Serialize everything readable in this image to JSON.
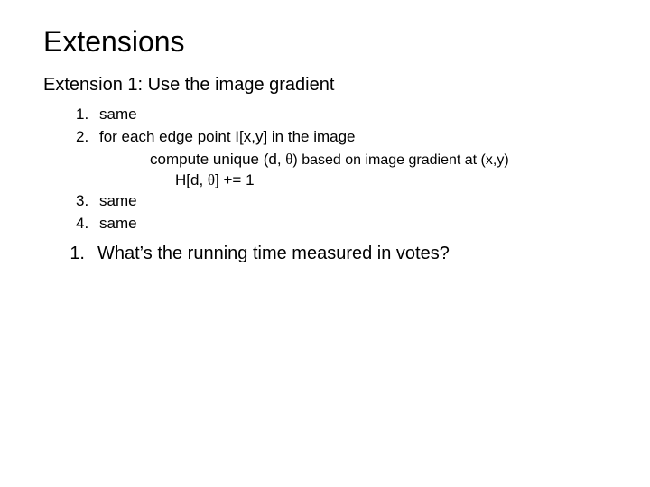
{
  "title": "Extensions",
  "subtitle": "Extension 1:  Use the image gradient",
  "steps": {
    "s1_num": "1.",
    "s1_text": "same",
    "s2_num": "2.",
    "s2_text": "for each edge point I[x,y] in the image",
    "s2_line_a_prefix": "compute unique (d, ",
    "theta1": "θ",
    "s2_line_a_suffix": ") based on image gradient at (x,y)",
    "s2_line_b_prefix": "H[d, ",
    "theta2": "θ",
    "s2_line_b_suffix": "] += 1",
    "s3_num": "3.",
    "s3_text": "same",
    "s4_num": "4.",
    "s4_text": "same"
  },
  "question": {
    "num": "1.",
    "text": "What’s the running time measured in votes?"
  }
}
